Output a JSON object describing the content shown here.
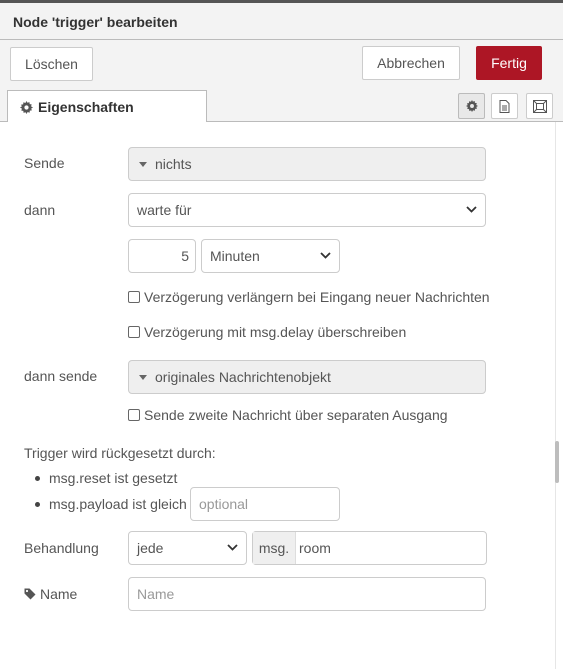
{
  "header": {
    "title": "Node 'trigger' bearbeiten"
  },
  "buttons": {
    "delete": "Löschen",
    "cancel": "Abbrechen",
    "done": "Fertig"
  },
  "tab": {
    "label": "Eigenschaften"
  },
  "form": {
    "send_label": "Sende",
    "send_value": "nichts",
    "then_label": "dann",
    "then_value": "warte für",
    "delay_amount": "5",
    "delay_unit": "Minuten",
    "extend_checkbox": "Verzögerung verlängern bei Eingang neuer Nachrichten",
    "override_checkbox": "Verzögerung mit msg.delay überschreiben",
    "then_send_label": "dann sende",
    "then_send_value": "originales Nachrichtenobjekt",
    "second_output_checkbox": "Sende zweite Nachricht über separaten Ausgang",
    "reset_heading": "Trigger wird rückgesetzt durch:",
    "reset_item_1": "msg.reset ist gesetzt",
    "reset_item_2": "msg.payload ist gleich",
    "reset_placeholder": "optional",
    "handling_label": "Behandlung",
    "handling_value": "jede",
    "msg_prefix": "msg.",
    "msg_property": "room",
    "name_label": "Name",
    "name_placeholder": "Name"
  }
}
